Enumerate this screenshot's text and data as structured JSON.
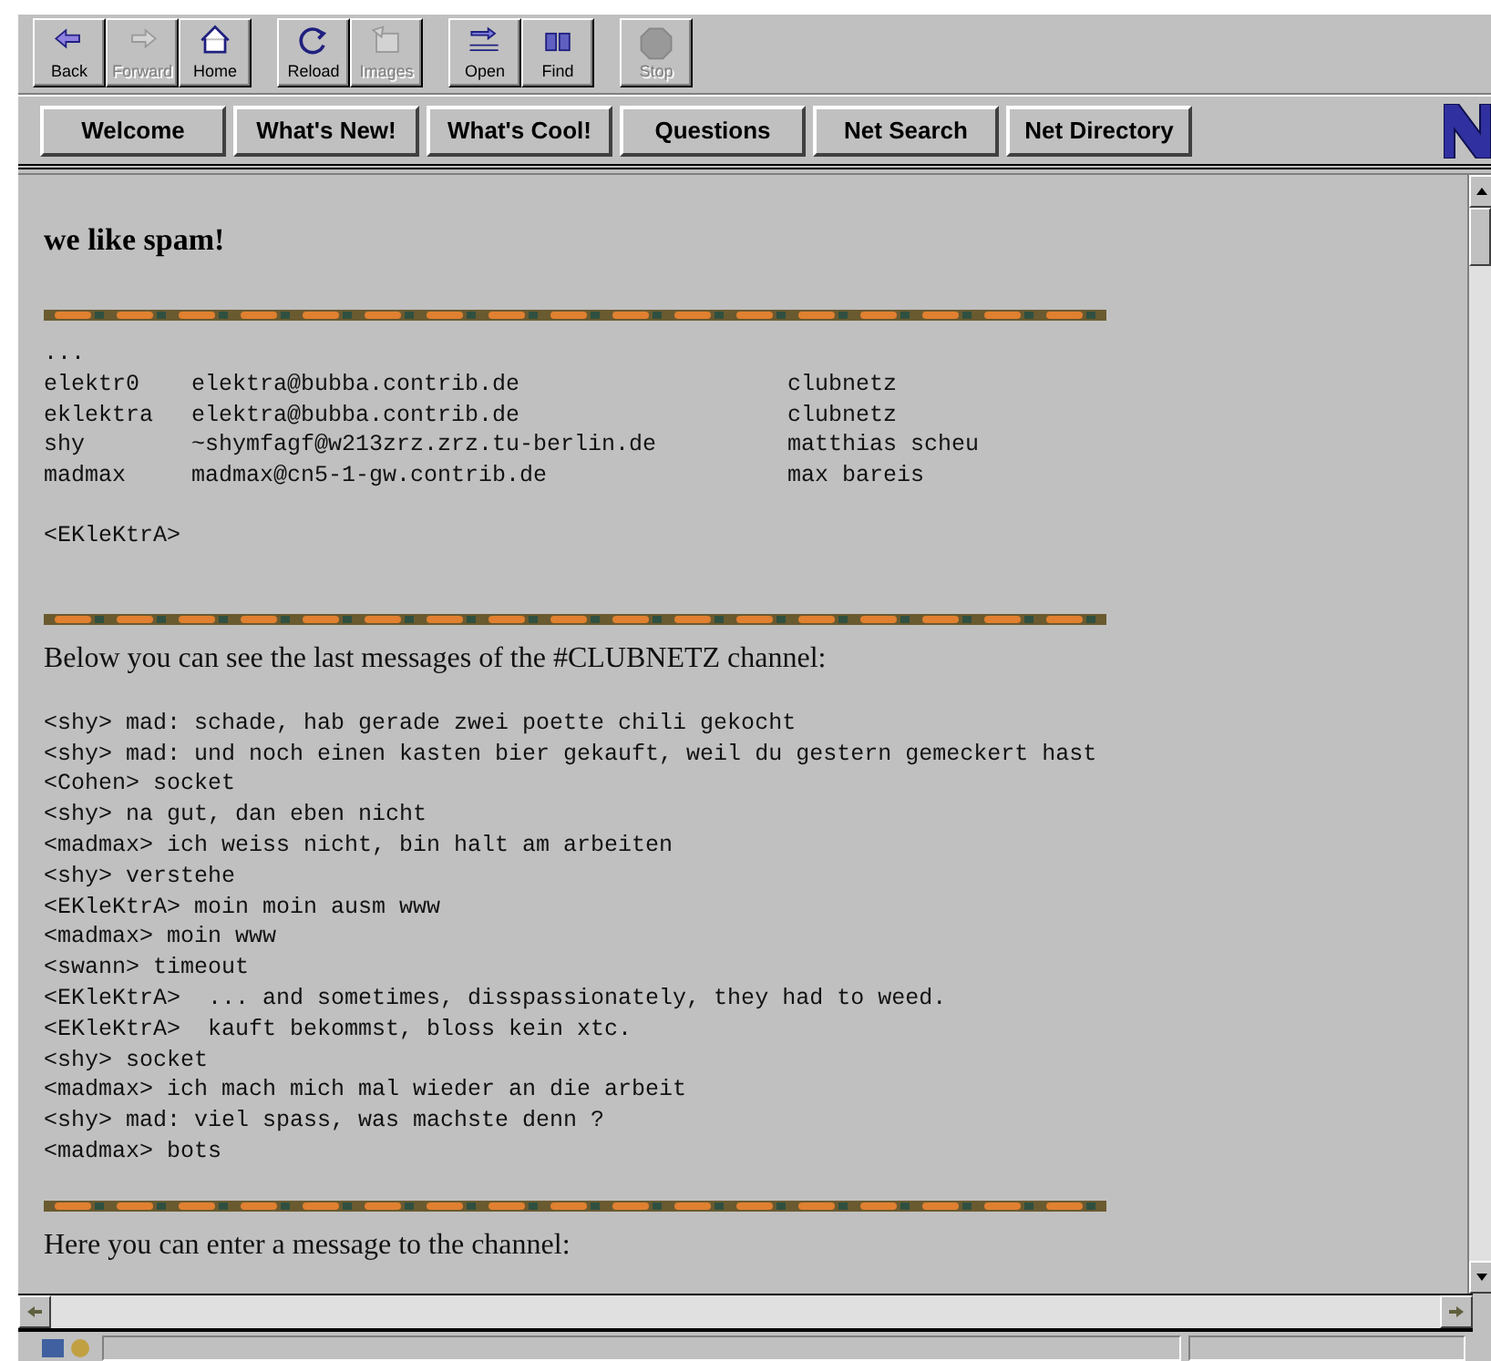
{
  "toolbar": [
    [
      {
        "label": "Back",
        "disabled": false
      },
      {
        "label": "Forward",
        "disabled": true
      },
      {
        "label": "Home",
        "disabled": false
      }
    ],
    [
      {
        "label": "Reload",
        "disabled": false
      },
      {
        "label": "Images",
        "disabled": true
      }
    ],
    [
      {
        "label": "Open",
        "disabled": false
      },
      {
        "label": "Find",
        "disabled": false
      }
    ],
    [
      {
        "label": "Stop",
        "disabled": true
      }
    ]
  ],
  "directory_buttons": [
    "Welcome",
    "What's New!",
    "What's Cool!",
    "Questions",
    "Net Search",
    "Net Directory"
  ],
  "content": [
    {
      "kind": "heading",
      "text": "we like spam!"
    },
    {
      "kind": "rule"
    },
    {
      "kind": "pre",
      "text": "..."
    },
    {
      "kind": "listing",
      "rows": [
        [
          "elektr0",
          "elektra@bubba.contrib.de",
          "clubnetz"
        ],
        [
          "eklektra",
          "elektra@bubba.contrib.de",
          "clubnetz"
        ],
        [
          "shy",
          "~shymfagf@w213zrz.zrz.tu-berlin.de",
          "matthias scheu"
        ],
        [
          "madmax",
          "madmax@cn5-1-gw.contrib.de",
          "max bareis"
        ]
      ]
    },
    {
      "kind": "signature",
      "text": "<EKleKtrA>"
    },
    {
      "kind": "rule"
    },
    {
      "kind": "paragraph",
      "text": "Below you can see the last messages of the #CLUBNETZ channel:"
    },
    {
      "kind": "chat",
      "lines": [
        "<shy> mad: schade, hab gerade zwei poette chili gekocht",
        "<shy> mad: und noch einen kasten bier gekauft, weil du gestern gemeckert hast",
        "<Cohen> socket",
        "<shy> na gut, dan eben nicht",
        "<madmax> ich weiss nicht, bin halt am arbeiten",
        "<shy> verstehe",
        "<EKleKtrA> moin moin ausm www",
        "<madmax> moin www",
        "<swann> timeout",
        "<EKleKtrA>  ... and sometimes, disspassionately, they had to weed.",
        "<EKleKtrA>  kauft bekommst, bloss kein xtc.",
        "<shy> socket",
        "<madmax> ich mach mich mal wieder an die arbeit",
        "<shy> mad: viel spass, was machste denn ?",
        "<madmax> bots"
      ]
    },
    {
      "kind": "rule"
    },
    {
      "kind": "paragraph",
      "text": "Here you can enter a message to the channel:"
    }
  ]
}
